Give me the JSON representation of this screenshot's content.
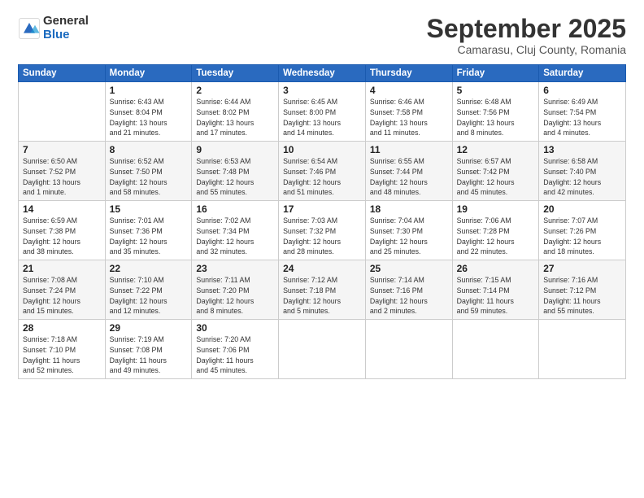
{
  "header": {
    "logo_general": "General",
    "logo_blue": "Blue",
    "month_title": "September 2025",
    "subtitle": "Camarasu, Cluj County, Romania"
  },
  "days_of_week": [
    "Sunday",
    "Monday",
    "Tuesday",
    "Wednesday",
    "Thursday",
    "Friday",
    "Saturday"
  ],
  "weeks": [
    [
      {
        "day": "",
        "info": ""
      },
      {
        "day": "1",
        "info": "Sunrise: 6:43 AM\nSunset: 8:04 PM\nDaylight: 13 hours\nand 21 minutes."
      },
      {
        "day": "2",
        "info": "Sunrise: 6:44 AM\nSunset: 8:02 PM\nDaylight: 13 hours\nand 17 minutes."
      },
      {
        "day": "3",
        "info": "Sunrise: 6:45 AM\nSunset: 8:00 PM\nDaylight: 13 hours\nand 14 minutes."
      },
      {
        "day": "4",
        "info": "Sunrise: 6:46 AM\nSunset: 7:58 PM\nDaylight: 13 hours\nand 11 minutes."
      },
      {
        "day": "5",
        "info": "Sunrise: 6:48 AM\nSunset: 7:56 PM\nDaylight: 13 hours\nand 8 minutes."
      },
      {
        "day": "6",
        "info": "Sunrise: 6:49 AM\nSunset: 7:54 PM\nDaylight: 13 hours\nand 4 minutes."
      }
    ],
    [
      {
        "day": "7",
        "info": "Sunrise: 6:50 AM\nSunset: 7:52 PM\nDaylight: 13 hours\nand 1 minute."
      },
      {
        "day": "8",
        "info": "Sunrise: 6:52 AM\nSunset: 7:50 PM\nDaylight: 12 hours\nand 58 minutes."
      },
      {
        "day": "9",
        "info": "Sunrise: 6:53 AM\nSunset: 7:48 PM\nDaylight: 12 hours\nand 55 minutes."
      },
      {
        "day": "10",
        "info": "Sunrise: 6:54 AM\nSunset: 7:46 PM\nDaylight: 12 hours\nand 51 minutes."
      },
      {
        "day": "11",
        "info": "Sunrise: 6:55 AM\nSunset: 7:44 PM\nDaylight: 12 hours\nand 48 minutes."
      },
      {
        "day": "12",
        "info": "Sunrise: 6:57 AM\nSunset: 7:42 PM\nDaylight: 12 hours\nand 45 minutes."
      },
      {
        "day": "13",
        "info": "Sunrise: 6:58 AM\nSunset: 7:40 PM\nDaylight: 12 hours\nand 42 minutes."
      }
    ],
    [
      {
        "day": "14",
        "info": "Sunrise: 6:59 AM\nSunset: 7:38 PM\nDaylight: 12 hours\nand 38 minutes."
      },
      {
        "day": "15",
        "info": "Sunrise: 7:01 AM\nSunset: 7:36 PM\nDaylight: 12 hours\nand 35 minutes."
      },
      {
        "day": "16",
        "info": "Sunrise: 7:02 AM\nSunset: 7:34 PM\nDaylight: 12 hours\nand 32 minutes."
      },
      {
        "day": "17",
        "info": "Sunrise: 7:03 AM\nSunset: 7:32 PM\nDaylight: 12 hours\nand 28 minutes."
      },
      {
        "day": "18",
        "info": "Sunrise: 7:04 AM\nSunset: 7:30 PM\nDaylight: 12 hours\nand 25 minutes."
      },
      {
        "day": "19",
        "info": "Sunrise: 7:06 AM\nSunset: 7:28 PM\nDaylight: 12 hours\nand 22 minutes."
      },
      {
        "day": "20",
        "info": "Sunrise: 7:07 AM\nSunset: 7:26 PM\nDaylight: 12 hours\nand 18 minutes."
      }
    ],
    [
      {
        "day": "21",
        "info": "Sunrise: 7:08 AM\nSunset: 7:24 PM\nDaylight: 12 hours\nand 15 minutes."
      },
      {
        "day": "22",
        "info": "Sunrise: 7:10 AM\nSunset: 7:22 PM\nDaylight: 12 hours\nand 12 minutes."
      },
      {
        "day": "23",
        "info": "Sunrise: 7:11 AM\nSunset: 7:20 PM\nDaylight: 12 hours\nand 8 minutes."
      },
      {
        "day": "24",
        "info": "Sunrise: 7:12 AM\nSunset: 7:18 PM\nDaylight: 12 hours\nand 5 minutes."
      },
      {
        "day": "25",
        "info": "Sunrise: 7:14 AM\nSunset: 7:16 PM\nDaylight: 12 hours\nand 2 minutes."
      },
      {
        "day": "26",
        "info": "Sunrise: 7:15 AM\nSunset: 7:14 PM\nDaylight: 11 hours\nand 59 minutes."
      },
      {
        "day": "27",
        "info": "Sunrise: 7:16 AM\nSunset: 7:12 PM\nDaylight: 11 hours\nand 55 minutes."
      }
    ],
    [
      {
        "day": "28",
        "info": "Sunrise: 7:18 AM\nSunset: 7:10 PM\nDaylight: 11 hours\nand 52 minutes."
      },
      {
        "day": "29",
        "info": "Sunrise: 7:19 AM\nSunset: 7:08 PM\nDaylight: 11 hours\nand 49 minutes."
      },
      {
        "day": "30",
        "info": "Sunrise: 7:20 AM\nSunset: 7:06 PM\nDaylight: 11 hours\nand 45 minutes."
      },
      {
        "day": "",
        "info": ""
      },
      {
        "day": "",
        "info": ""
      },
      {
        "day": "",
        "info": ""
      },
      {
        "day": "",
        "info": ""
      }
    ]
  ]
}
